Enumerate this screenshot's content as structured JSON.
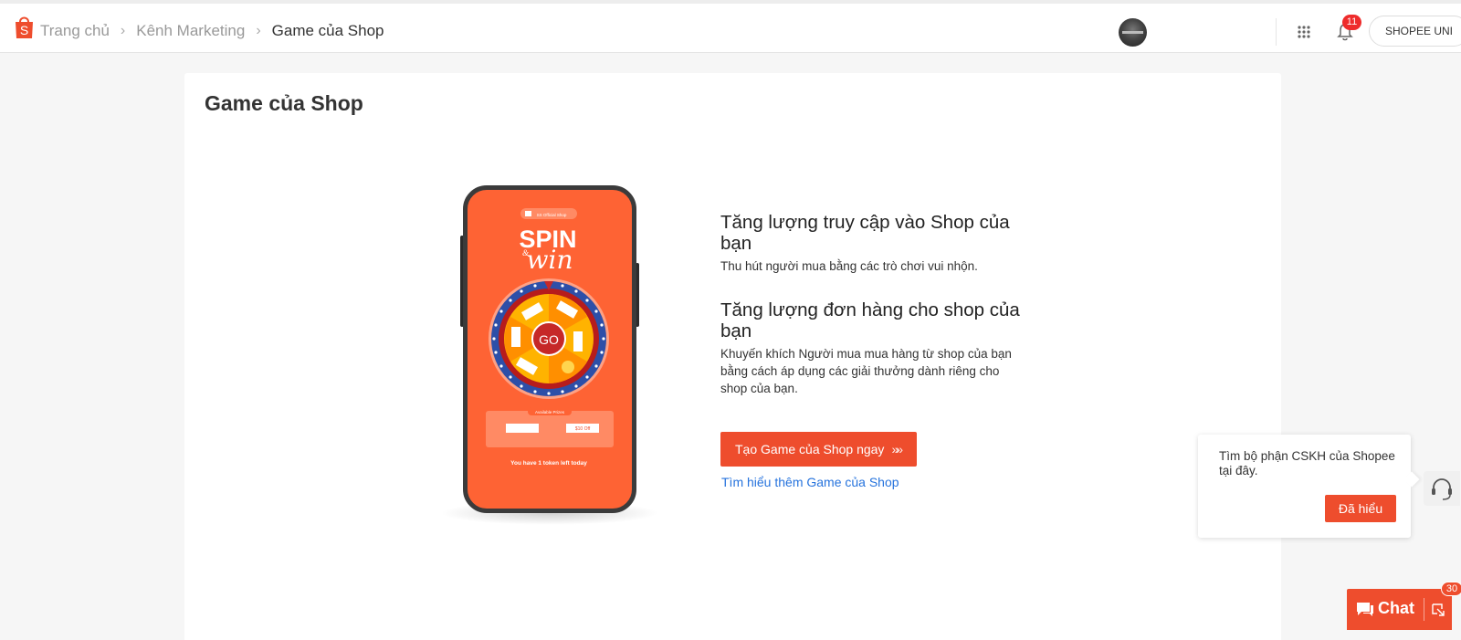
{
  "header": {
    "logo": "shopee-bag-logo",
    "breadcrumb": [
      "Trang chủ",
      "Kênh Marketing",
      "Game của Shop"
    ],
    "notification_count": "11",
    "shop_button": "SHOPEE UNI"
  },
  "main": {
    "title": "Game của Shop",
    "illustration": {
      "brand_tag": "SS Official Shop",
      "spin_text": "SPIN",
      "amp_text": "&",
      "win_text": "win",
      "go_label": "GO",
      "prizes_label": "Available Prizes",
      "prize_right": "$10 Off",
      "token_text": "You have 1 token left today"
    },
    "benefits": [
      {
        "heading": "Tăng lượng truy cập vào Shop của bạn",
        "description": "Thu hút người mua bằng các trò chơi vui nhộn."
      },
      {
        "heading": "Tăng lượng đơn hàng cho shop của bạn",
        "description": "Khuyến khích Người mua mua hàng từ shop của bạn bằng cách áp dụng các giải thưởng dành riêng cho shop của bạn."
      }
    ],
    "cta_label": "Tạo Game của Shop ngay",
    "cta_arrows": "»»",
    "learn_more": "Tìm hiểu thêm Game của Shop"
  },
  "tooltip": {
    "text": "Tìm bộ phận CSKH của Shopee tại đây.",
    "button": "Đã hiểu"
  },
  "chat": {
    "label": "Chat",
    "badge": "30"
  },
  "colors": {
    "brand": "#ee4d2d",
    "phone_bg": "#fe6334",
    "link": "#2673dd"
  }
}
